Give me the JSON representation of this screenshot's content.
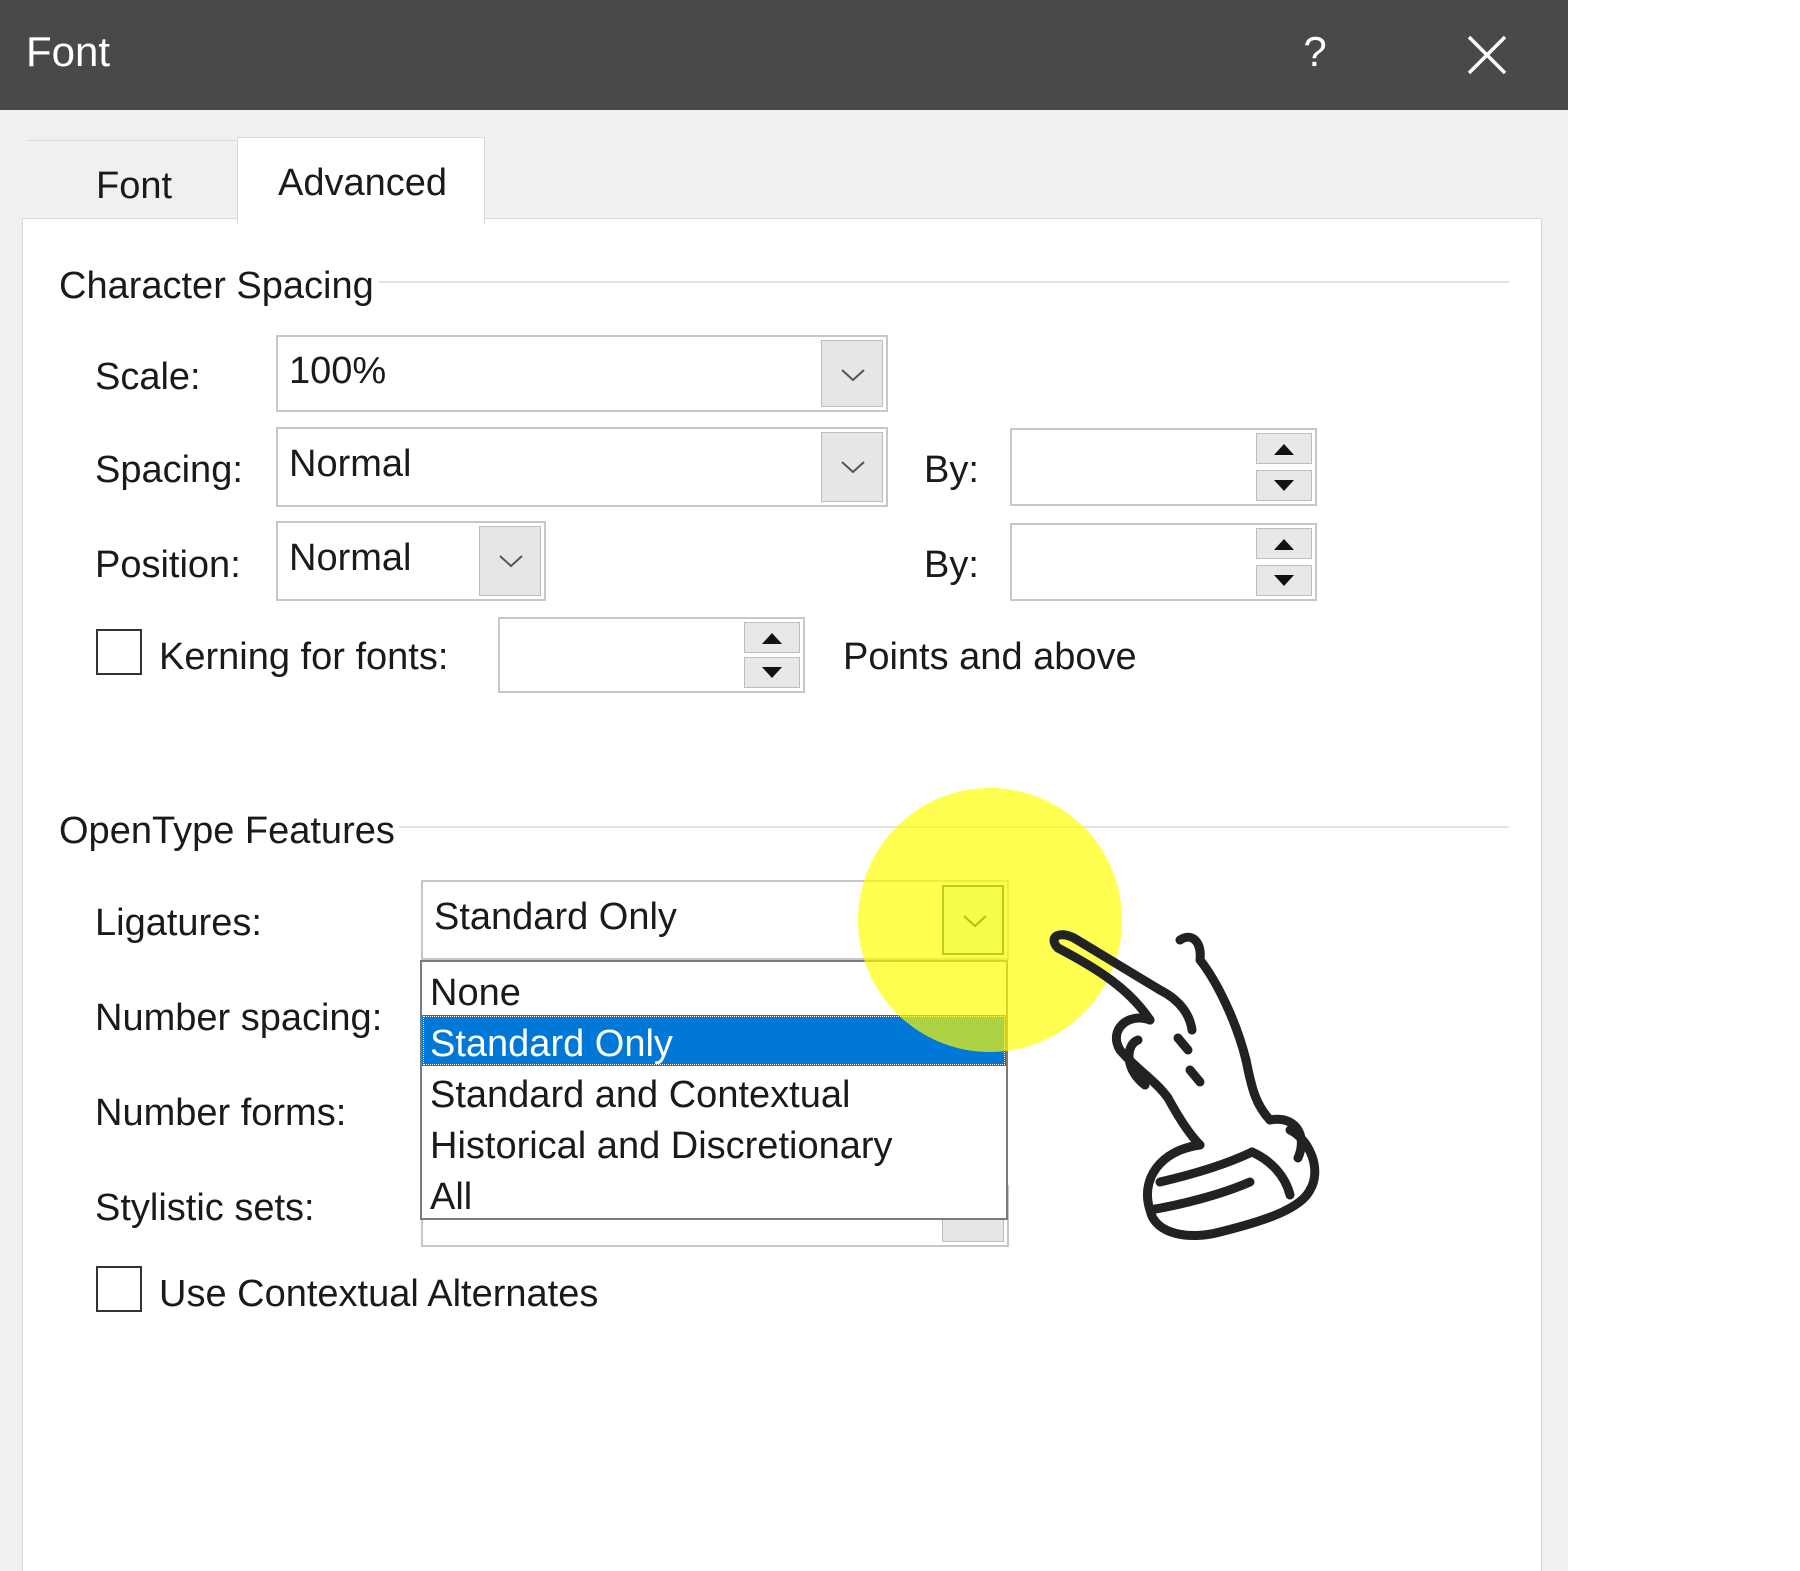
{
  "dialog": {
    "title": "Font",
    "help_label": "?",
    "close_icon": "close-icon"
  },
  "tabs": [
    {
      "label": "Font",
      "selected": false
    },
    {
      "label": "Advanced",
      "selected": true
    }
  ],
  "character_spacing": {
    "section_title": "Character Spacing",
    "scale": {
      "label": "Scale:",
      "value": "100%"
    },
    "spacing": {
      "label": "Spacing:",
      "value": "Normal",
      "by_label": "By:",
      "by_value": ""
    },
    "position": {
      "label": "Position:",
      "value": "Normal",
      "by_label": "By:",
      "by_value": ""
    },
    "kerning": {
      "label": "Kerning for fonts:",
      "checked": false,
      "value": "",
      "suffix": "Points and above"
    }
  },
  "opentype": {
    "section_title": "OpenType Features",
    "ligatures": {
      "label": "Ligatures:",
      "value": "Standard Only",
      "options": [
        "None",
        "Standard Only",
        "Standard and Contextual",
        "Historical and Discretionary",
        "All"
      ],
      "selected_option": "Standard Only"
    },
    "number_spacing": {
      "label": "Number spacing:"
    },
    "number_forms": {
      "label": "Number forms:"
    },
    "stylistic_sets": {
      "label": "Stylistic sets:"
    },
    "contextual_alternates": {
      "label": "Use Contextual Alternates",
      "checked": false
    }
  },
  "colors": {
    "titlebar": "#4a4948",
    "selection": "#0078d7",
    "highlight": "#ffff00"
  },
  "icons": {
    "chevron": "chevron-down-icon",
    "spin_up": "arrow-up-icon",
    "spin_down": "arrow-down-icon",
    "pointer": "pointing-hand-icon"
  }
}
